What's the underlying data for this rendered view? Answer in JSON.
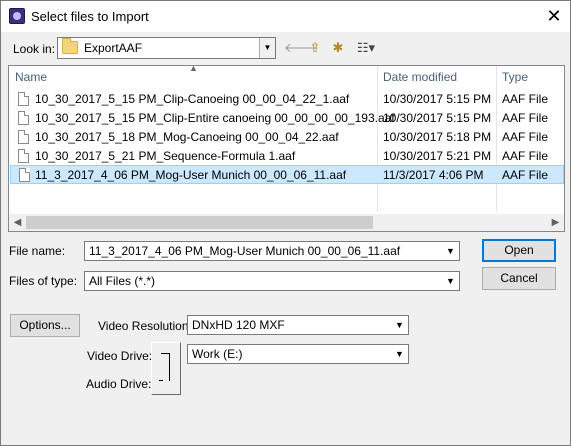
{
  "window": {
    "title": "Select files to Import",
    "close": "✕"
  },
  "lookin": {
    "label": "Look in:",
    "value": "ExportAAF"
  },
  "toolbar": {
    "back": "🡐",
    "up": "⇧",
    "new_folder": "✱",
    "view_menu": "☷▾"
  },
  "columns": {
    "name": "Name",
    "date": "Date modified",
    "type": "Type"
  },
  "files": [
    {
      "name": "10_30_2017_5_15 PM_Clip-Canoeing 00_00_04_22_1.aaf",
      "date": "10/30/2017 5:15 PM",
      "type": "AAF File"
    },
    {
      "name": "10_30_2017_5_15 PM_Clip-Entire canoeing 00_00_00_00_193.aaf",
      "date": "10/30/2017 5:15 PM",
      "type": "AAF File"
    },
    {
      "name": "10_30_2017_5_18 PM_Mog-Canoeing 00_00_04_22.aaf",
      "date": "10/30/2017 5:18 PM",
      "type": "AAF File"
    },
    {
      "name": "10_30_2017_5_21 PM_Sequence-Formula 1.aaf",
      "date": "10/30/2017 5:21 PM",
      "type": "AAF File"
    },
    {
      "name": "11_3_2017_4_06 PM_Mog-User Munich 00_00_06_11.aaf",
      "date": "11/3/2017 4:06 PM",
      "type": "AAF File",
      "selected": true
    }
  ],
  "scroll": {
    "left": "◀",
    "right": "▶"
  },
  "filename": {
    "label": "File name:",
    "value": "11_3_2017_4_06 PM_Mog-User Munich 00_00_06_11.aaf"
  },
  "filetype": {
    "label": "Files of type:",
    "value": "All Files (*.*)"
  },
  "buttons": {
    "open": "Open",
    "cancel": "Cancel",
    "options": "Options..."
  },
  "video_resolution": {
    "label": "Video Resolution:",
    "value": "DNxHD 120  MXF"
  },
  "video_drive": {
    "label": "Video Drive:",
    "value": "Work (E:)"
  },
  "audio_drive": {
    "label": "Audio Drive:"
  },
  "colors": {
    "selection": "#cce8ff",
    "selection_border": "#99d1ff",
    "default_button": "#0078d7"
  }
}
